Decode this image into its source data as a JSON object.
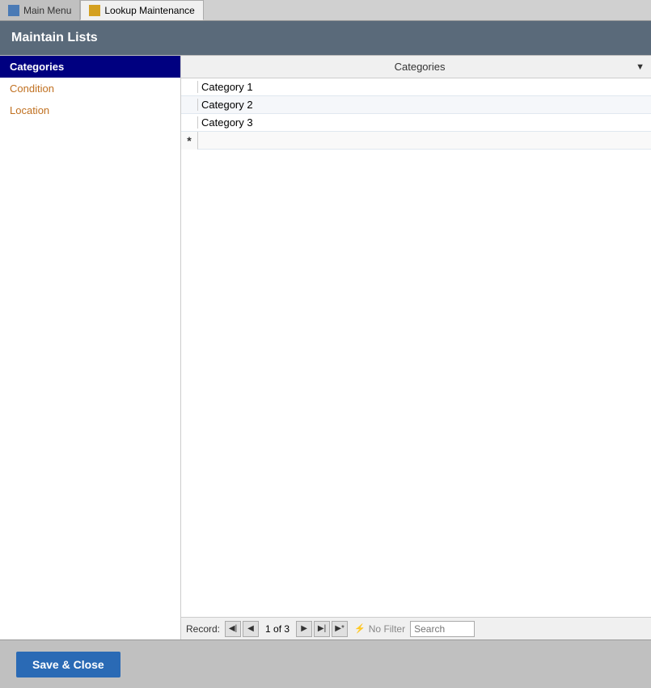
{
  "tabs": [
    {
      "id": "main-menu",
      "label": "Main Menu",
      "active": false,
      "icon": "main-icon"
    },
    {
      "id": "lookup-maintenance",
      "label": "Lookup Maintenance",
      "active": true,
      "icon": "lookup-icon"
    }
  ],
  "section_title": "Maintain Lists",
  "sidebar": {
    "items": [
      {
        "id": "categories",
        "label": "Categories",
        "selected": true
      },
      {
        "id": "condition",
        "label": "Condition",
        "selected": false
      },
      {
        "id": "location",
        "label": "Location",
        "selected": false
      }
    ]
  },
  "table": {
    "column_header": "Categories",
    "dropdown_symbol": "▼",
    "rows": [
      {
        "value": "Category 1"
      },
      {
        "value": "Category 2"
      },
      {
        "value": "Category 3"
      }
    ]
  },
  "nav_bar": {
    "record_label": "Record:",
    "record_info": "1 of 3",
    "filter_label": "No Filter",
    "search_placeholder": "Search",
    "buttons": {
      "first": "◀|",
      "prev": "◀",
      "next": "▶",
      "last": "▶|",
      "new": "▶*"
    }
  },
  "footer": {
    "save_close_label": "Save & Close"
  }
}
